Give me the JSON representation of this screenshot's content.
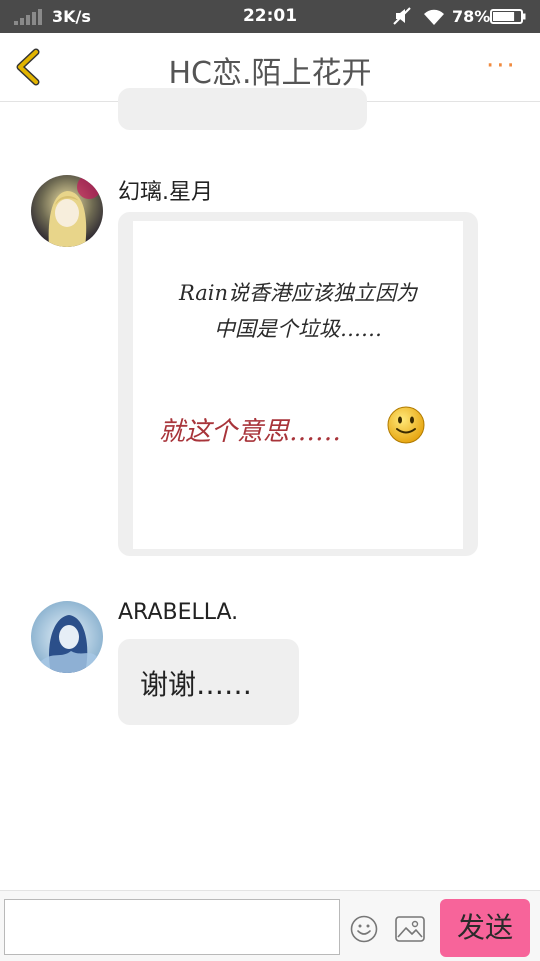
{
  "status_bar": {
    "network_speed": "3K/s",
    "time": "22:01",
    "battery_percent": "78%",
    "battery_level": 0.78
  },
  "header": {
    "title": "HC恋.陌上花开",
    "more_label": "···"
  },
  "messages": [
    {
      "sender": "幻璃.星月",
      "type": "image",
      "image_text": {
        "line1": "Rain说香港应该独立因为",
        "line2": "中国是个垃圾……",
        "line3": "就这个意思……"
      }
    },
    {
      "sender": "ARABELLA.",
      "type": "text",
      "text": "谢谢……"
    }
  ],
  "input_bar": {
    "placeholder": "",
    "send_label": "发送"
  },
  "colors": {
    "status_bar_bg": "#4a4a4a",
    "accent_back": "#e2b400",
    "accent_more": "#f08a3e",
    "send_button": "#f7649a",
    "bubble": "#efefef",
    "handwriting_red": "#a8343a"
  }
}
